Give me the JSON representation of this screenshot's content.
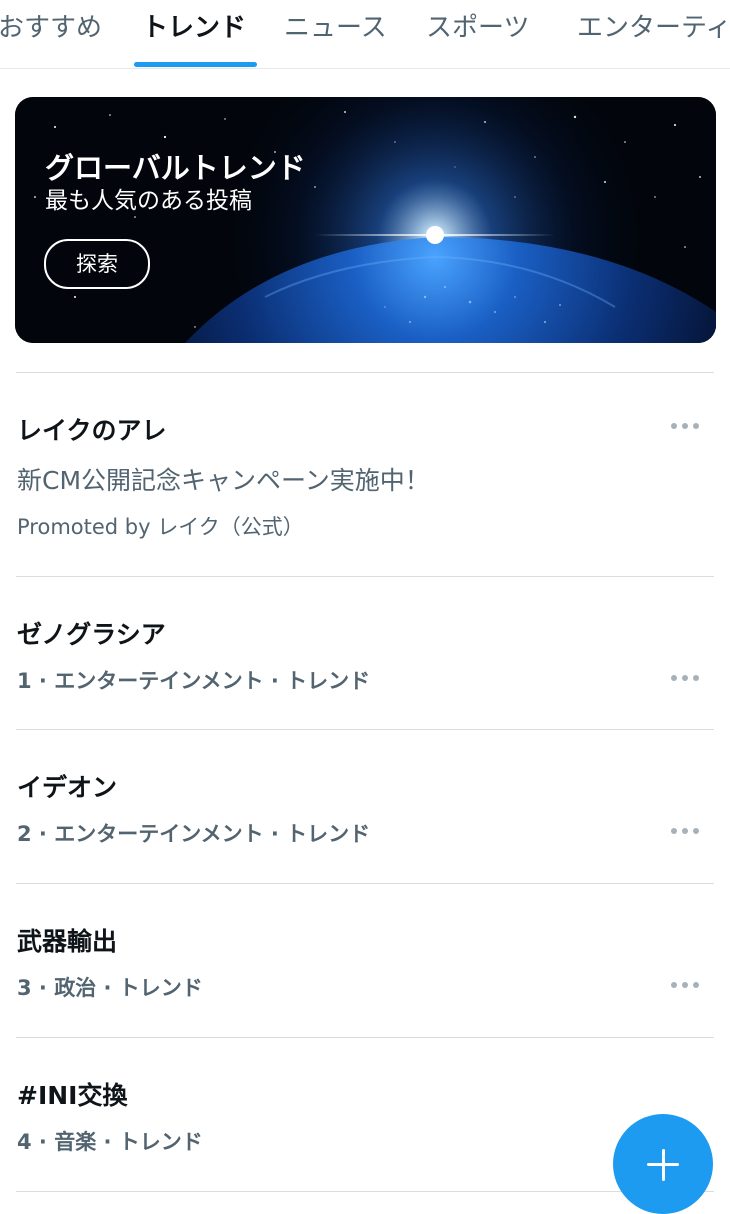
{
  "tabs": [
    {
      "label": "おすすめ",
      "active": false
    },
    {
      "label": "トレンド",
      "active": true
    },
    {
      "label": "ニュース",
      "active": false
    },
    {
      "label": "スポーツ",
      "active": false
    },
    {
      "label": "エンターティ",
      "active": false
    }
  ],
  "banner": {
    "title": "グローバルトレンド",
    "subtitle": "最も人気のある投稿",
    "button_label": "探索"
  },
  "promoted": {
    "title": "レイクのアレ",
    "description": "新CM公開記念キャンペーン実施中！",
    "promoted_by": "Promoted by レイク（公式）"
  },
  "trends": [
    {
      "title": "ゼノグラシア",
      "meta": "1 · エンターテインメント · トレンド"
    },
    {
      "title": "イデオン",
      "meta": "2 · エンターテインメント · トレンド"
    },
    {
      "title": "武器輸出",
      "meta": "3 · 政治 · トレンド"
    },
    {
      "title": "#INI交換",
      "meta": "4 · 音楽 · トレンド"
    }
  ],
  "icons": {
    "more": "more-horizontal-icon",
    "compose": "plus-icon"
  },
  "colors": {
    "accent": "#1d9bf0",
    "text_primary": "#0f1419",
    "text_secondary": "#536471"
  }
}
